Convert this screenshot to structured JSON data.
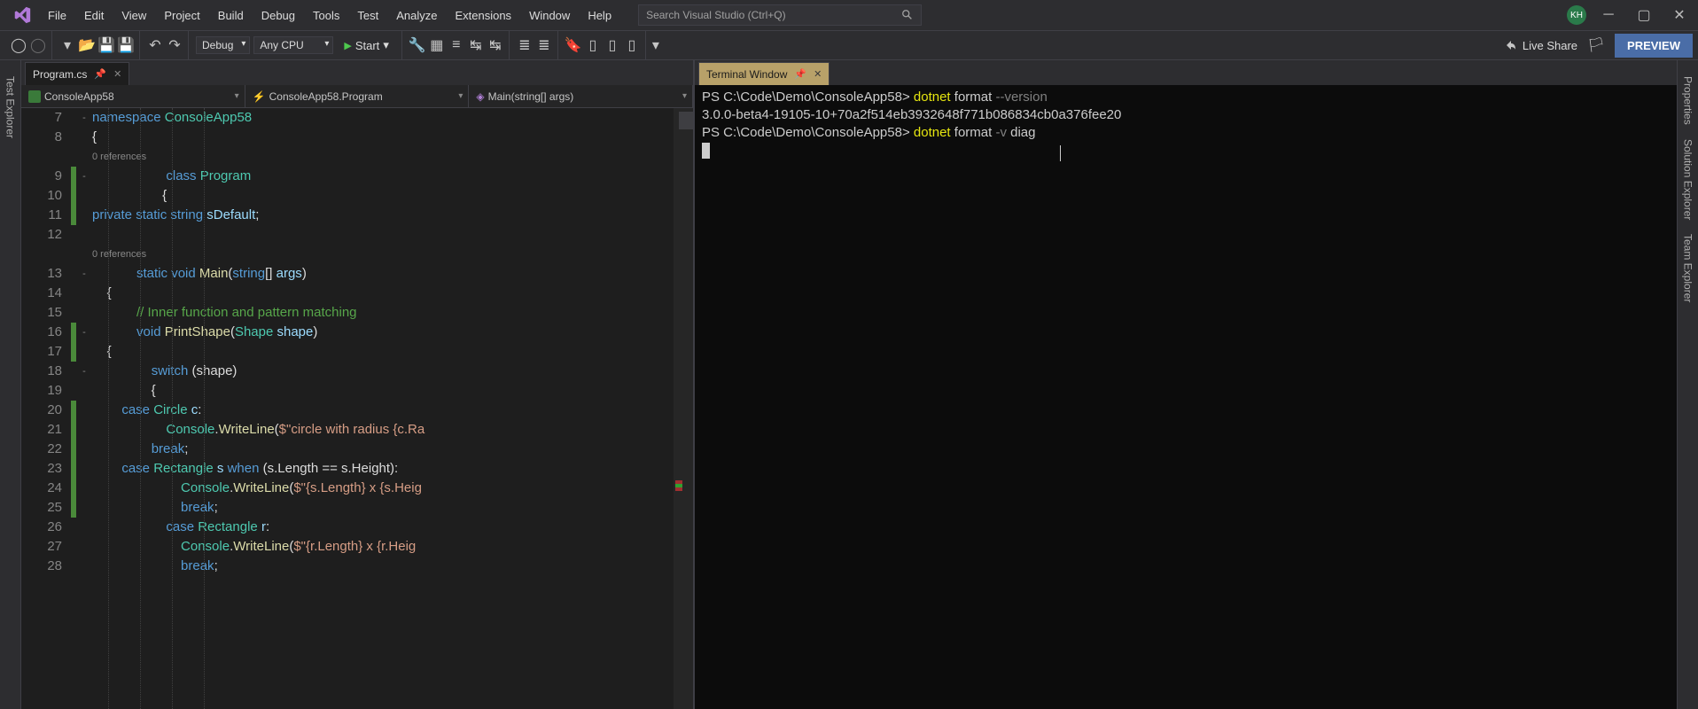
{
  "menu": {
    "items": [
      "File",
      "Edit",
      "View",
      "Project",
      "Build",
      "Debug",
      "Tools",
      "Test",
      "Analyze",
      "Extensions",
      "Window",
      "Help"
    ],
    "search_placeholder": "Search Visual Studio (Ctrl+Q)"
  },
  "avatar_initials": "KH",
  "toolbar": {
    "config": "Debug",
    "platform": "Any CPU",
    "start": "Start",
    "live_share": "Live Share",
    "preview": "PREVIEW"
  },
  "left_tabs": [
    "Test Explorer"
  ],
  "right_tabs": [
    "Properties",
    "Solution Explorer",
    "Team Explorer"
  ],
  "editor": {
    "tab_name": "Program.cs",
    "breadcrumbs": [
      "ConsoleApp58",
      "ConsoleApp58.Program",
      "Main(string[] args)"
    ],
    "lines": [
      {
        "n": 7,
        "fold": "-",
        "html": "<span class='kw'>namespace</span> <span class='type'>ConsoleApp58</span>"
      },
      {
        "n": 8,
        "html": "{"
      },
      {
        "ref": "                                    0 references"
      },
      {
        "n": 9,
        "fold": "-",
        "html": "                    <span class='kw'>class</span> <span class='type'>Program</span>",
        "mod": true
      },
      {
        "n": 10,
        "html": "                   {",
        "mod": true
      },
      {
        "n": 11,
        "html": "<span class='kw'>private</span> <span class='kw'>static</span> <span class='kw'>string</span> <span class='param'>sDefault</span>;",
        "mod": true
      },
      {
        "n": 12,
        "html": ""
      },
      {
        "ref": "                            0 references"
      },
      {
        "n": 13,
        "fold": "-",
        "html": "            <span class='kw'>static</span> <span class='kw'>void</span> <span class='mtd'>Main</span>(<span class='kw'>string</span>[] <span class='param'>args</span>)"
      },
      {
        "n": 14,
        "html": "    {"
      },
      {
        "n": 15,
        "html": "            <span class='cmt'>// Inner function and pattern matching</span>"
      },
      {
        "n": 16,
        "fold": "-",
        "html": "            <span class='kw'>void</span> <span class='mtd'>PrintShape</span>(<span class='type'>Shape</span> <span class='param'>shape</span>)",
        "mod": true
      },
      {
        "n": 17,
        "html": "    {",
        "mod": true
      },
      {
        "n": 18,
        "fold": "-",
        "html": "                <span class='kw'>switch</span> (shape)"
      },
      {
        "n": 19,
        "html": "                {"
      },
      {
        "n": 20,
        "html": "        <span class='kw'>case</span> <span class='type'>Circle</span> <span class='param'>c</span>:",
        "mod": true
      },
      {
        "n": 21,
        "html": "                    <span class='type'>Console</span>.<span class='mtd'>WriteLine</span>(<span class='str'>$\"circle with radius {c.Ra</span>",
        "mod": true
      },
      {
        "n": 22,
        "html": "                <span class='kw'>break</span>;",
        "mod": true
      },
      {
        "n": 23,
        "html": "        <span class='kw'>case</span> <span class='type'>Rectangle</span> <span class='param'>s</span> <span class='kw'>when</span> (s.Length == s.Height):",
        "mod": true
      },
      {
        "n": 24,
        "html": "                        <span class='type'>Console</span>.<span class='mtd'>WriteLine</span>(<span class='str'>$\"{s.Length} x {s.Heig</span>",
        "mod": true
      },
      {
        "n": 25,
        "html": "                        <span class='kw'>break</span>;",
        "mod": true
      },
      {
        "n": 26,
        "html": "                    <span class='kw'>case</span> <span class='type'>Rectangle</span> <span class='param'>r</span>:"
      },
      {
        "n": 27,
        "html": "                        <span class='type'>Console</span>.<span class='mtd'>WriteLine</span>(<span class='str'>$\"{r.Length} x {r.Heig</span>"
      },
      {
        "n": 28,
        "html": "                        <span class='kw'>break</span>;"
      }
    ]
  },
  "terminal": {
    "tab_name": "Terminal Window",
    "lines": [
      {
        "prompt": "PS C:\\Code\\Demo\\ConsoleApp58> ",
        "cmd": "dotnet",
        "args": " format ",
        "flag": "--version"
      },
      {
        "text": "3.0.0-beta4-19105-10+70a2f514eb3932648f771b086834cb0a376fee20"
      },
      {
        "prompt": "PS C:\\Code\\Demo\\ConsoleApp58> ",
        "cmd": "dotnet",
        "args": " format ",
        "flag": "-v",
        "tail": " diag"
      }
    ]
  }
}
